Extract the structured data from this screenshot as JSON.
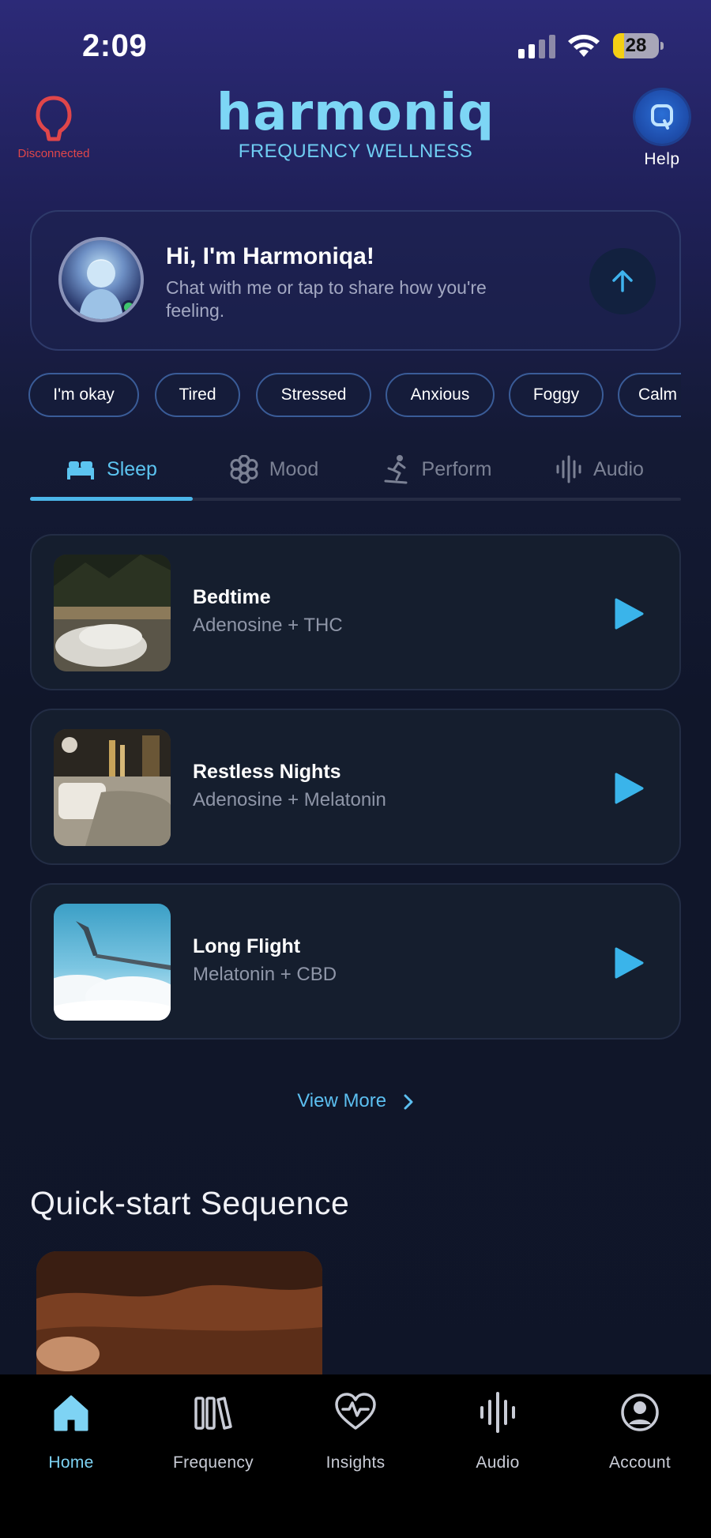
{
  "status_bar": {
    "time": "2:09",
    "battery": "28"
  },
  "header": {
    "device_status": "Disconnected",
    "brand_name": "harmoniq",
    "brand_tagline": "FREQUENCY WELLNESS",
    "help_label": "Help"
  },
  "chat": {
    "title": "Hi, I'm Harmoniqa!",
    "subtitle": "Chat with me or tap to share how you're feeling."
  },
  "moods": [
    "I'm okay",
    "Tired",
    "Stressed",
    "Anxious",
    "Foggy",
    "Calm"
  ],
  "tabs": [
    {
      "label": "Sleep",
      "icon": "bed-icon",
      "active": true
    },
    {
      "label": "Mood",
      "icon": "flower-icon",
      "active": false
    },
    {
      "label": "Perform",
      "icon": "skier-icon",
      "active": false
    },
    {
      "label": "Audio",
      "icon": "soundwave-icon",
      "active": false
    }
  ],
  "sessions": [
    {
      "title": "Bedtime",
      "subtitle": "Adenosine + THC"
    },
    {
      "title": "Restless Nights",
      "subtitle": "Adenosine + Melatonin"
    },
    {
      "title": "Long Flight",
      "subtitle": "Melatonin + CBD"
    }
  ],
  "view_more": "View More",
  "quick_start": {
    "title": "Quick-start Sequence"
  },
  "bottom_nav": [
    {
      "label": "Home",
      "icon": "home-icon",
      "active": true
    },
    {
      "label": "Frequency",
      "icon": "library-icon",
      "active": false
    },
    {
      "label": "Insights",
      "icon": "heart-pulse-icon",
      "active": false
    },
    {
      "label": "Audio",
      "icon": "soundwave-icon",
      "active": false
    },
    {
      "label": "Account",
      "icon": "account-icon",
      "active": false
    }
  ],
  "colors": {
    "accent": "#5cc4f0",
    "danger": "#e0464a",
    "card": "#151e2e"
  }
}
